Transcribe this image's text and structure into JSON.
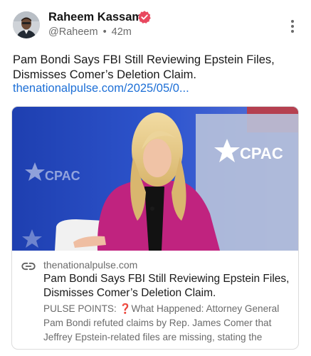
{
  "author": {
    "name": "Raheem Kassam",
    "handle": "@Raheem",
    "separator": "•",
    "time": "42m",
    "verified": true,
    "verified_color": "#e8485f"
  },
  "post": {
    "text": "Pam Bondi Says FBI Still Reviewing Epstein Files, Dismisses Comer’s Deletion Claim.",
    "link_text": "thenationalpulse.com/2025/05/0...",
    "link_color": "#1d6fd6"
  },
  "card": {
    "image_text": "CPAC",
    "domain": "thenationalpulse.com",
    "title": "Pam Bondi Says FBI Still Reviewing Epstein Files, Dismisses Comer’s Deletion Claim.",
    "description": "PULSE POINTS: ❓What Happened: Attorney General Pam Bondi refuted claims by Rep. James Comer that Jeffrey Epstein-related files are missing, stating the"
  },
  "icons": {
    "more": "more-vertical-icon",
    "link": "link-icon",
    "verified": "verified-badge-icon"
  }
}
